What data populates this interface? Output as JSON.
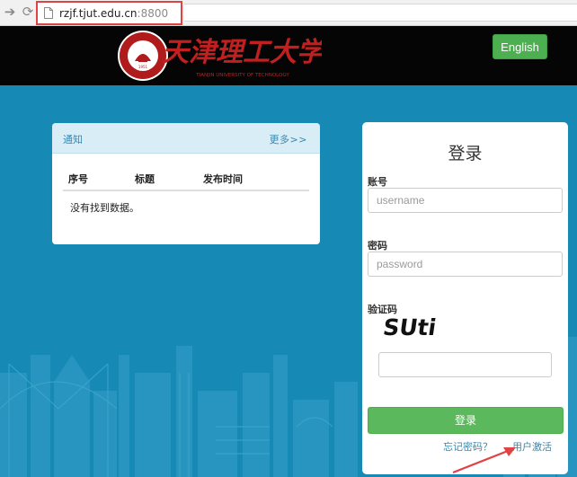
{
  "browser": {
    "url_host": "rzjf.tjut.edu.cn",
    "url_port": ":8800",
    "back_icon": "arrow-right-icon",
    "reload_icon": "reload-icon"
  },
  "header": {
    "logo_text": "天津理工大学",
    "logo_subtitle": "TIANJIN UNIVERSITY OF TECHNOLOGY",
    "seal_text": "TIANJIN UNIVERSITY OF TECHNOLOGY",
    "english_button": "English"
  },
  "notice": {
    "title": "通知",
    "more": "更多>>",
    "columns": [
      "序号",
      "标题",
      "发布时间"
    ],
    "empty_text": "没有找到数据。"
  },
  "login": {
    "title": "登录",
    "account_label": "账号",
    "username_placeholder": "username",
    "username_value": "",
    "password_label": "密码",
    "password_placeholder": "password",
    "password_value": "",
    "captcha_label": "验证码",
    "captcha_text": "SUti",
    "captcha_value": "",
    "submit_label": "登录",
    "forgot_label": "忘记密码？",
    "activate_label": "用户激活"
  },
  "colors": {
    "background_blue": "#1689b4",
    "header_black": "#050505",
    "green_button": "#5cb85c",
    "link_blue": "#3a87ad",
    "annotation_red": "#e04343"
  }
}
